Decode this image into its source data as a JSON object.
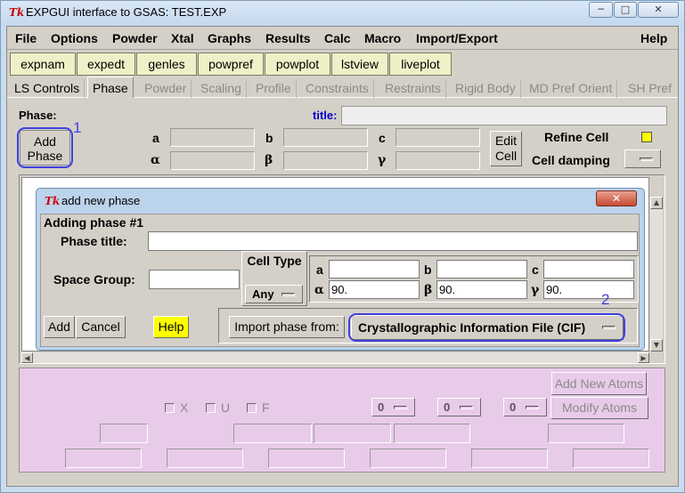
{
  "window": {
    "title": "EXPGUI interface to GSAS: TEST.EXP",
    "minimize": "─",
    "maximize": "□",
    "close": "✕",
    "tk_logo": "Tk"
  },
  "menubar": {
    "items": [
      "File",
      "Options",
      "Powder",
      "Xtal",
      "Graphs",
      "Results",
      "Calc",
      "Macro",
      "Import/Export"
    ],
    "help": "Help"
  },
  "toolbar": {
    "buttons": [
      "expnam",
      "expedt",
      "genles",
      "powpref",
      "powplot",
      "lstview",
      "liveplot"
    ]
  },
  "tabs": [
    "LS Controls",
    "Phase",
    "Powder",
    "Scaling",
    "Profile",
    "Constraints",
    "Restraints",
    "Rigid Body",
    "MD Pref Orient",
    "SH Pref"
  ],
  "phase_panel": {
    "phase_label": "Phase:",
    "title_label": "title:",
    "add_phase": "Add Phase",
    "annotation_1": "1",
    "cell_labels": [
      "a",
      "b",
      "c",
      "α",
      "β",
      "γ"
    ],
    "edit_cell": "Edit Cell",
    "refine_cell": "Refine Cell",
    "cell_damping": "Cell damping"
  },
  "dialog": {
    "title": "add new phase",
    "close": "✕",
    "heading": "Adding phase #1",
    "phase_title_label": "Phase title:",
    "space_group_label": "Space Group:",
    "cell_type_label": "Cell Type",
    "cell_type_value": "Any",
    "cell_a": "",
    "cell_b": "",
    "cell_c": "",
    "alpha": "90.",
    "beta": "90.",
    "gamma": "90.",
    "add": "Add",
    "cancel": "Cancel",
    "help": "Help",
    "import_label": "Import phase from:",
    "import_value": "Crystallographic Information File (CIF)",
    "annotation_2": "2"
  },
  "atoms_panel": {
    "add_new_atoms": "Add New Atoms",
    "modify_atoms": "Modify Atoms",
    "x": "X",
    "u": "U",
    "f": "F",
    "dropdowns": [
      "0",
      "0",
      "0"
    ]
  },
  "colors": {
    "annotation": "#4040e0",
    "help_yellow": "#ffff00",
    "pink_panel": "#e8cbe8",
    "title_blue": "#0000c0"
  }
}
